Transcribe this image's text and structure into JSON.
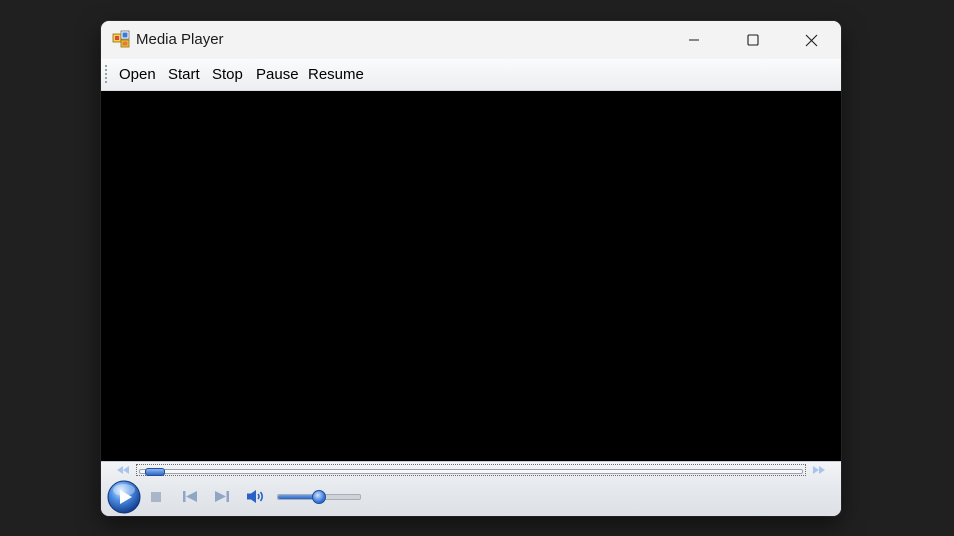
{
  "window": {
    "title": "Media Player"
  },
  "menu": {
    "items": [
      "Open",
      "Start",
      "Stop",
      "Pause",
      "Resume"
    ]
  },
  "player": {
    "seek_progress": 0.01,
    "volume_level": 0.5
  },
  "colors": {
    "desktop": "#202020",
    "video_background": "#000000",
    "accent_blue": "#2d67c9"
  },
  "icons": {
    "app": "media-player-app-icon",
    "minimize": "minimize-icon",
    "maximize": "maximize-icon",
    "close": "close-icon",
    "rewind": "rewind-icon",
    "fast_forward": "fast-forward-icon",
    "play": "play-icon",
    "stop": "stop-icon",
    "previous": "previous-track-icon",
    "next": "next-track-icon",
    "volume": "speaker-icon"
  }
}
